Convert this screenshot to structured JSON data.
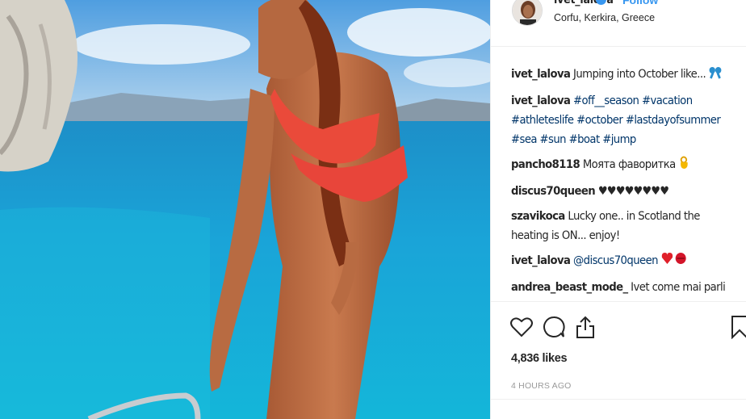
{
  "photo": {
    "alt_icon": "photo-of-woman-on-boat"
  },
  "header": {
    "username": "ivet_lalova",
    "follow_label": "Follow",
    "location": "Corfu, Kerkira, Greece"
  },
  "comments": [
    {
      "user": "ivet_lalova",
      "text": "Jumping into October like...",
      "emoji": "ribbon-icon"
    },
    {
      "user": "ivet_lalova",
      "text": "#off__season #vacation #athleteslife #october #lastdayofsummer #sea #sun #boat #jump"
    },
    {
      "user": "pancho8118",
      "text": "Моята фаворитка",
      "emoji": "ok-hand-icon"
    },
    {
      "user": "discus70queen",
      "text": "♥♥♥♥♥♥♥♥"
    },
    {
      "user": "szavikoca",
      "text": "Lucky one.. in Scotland the heating is ON... enjoy!"
    },
    {
      "user": "ivet_lalova",
      "mention": "@discus70queen",
      "emoji": "heart-lips-icon"
    },
    {
      "user": "andrea_beast_mode_",
      "text": "Ivet come mai parli"
    }
  ],
  "actions": {
    "likes": "4,836 likes",
    "time": "4 HOURS AGO",
    "icons": [
      "heart-icon",
      "comment-icon",
      "share-icon",
      "bookmark-icon"
    ]
  },
  "colors": {
    "link": "#003569",
    "follow": "#3897f0",
    "border": "#efefef",
    "text": "#262626",
    "muted": "#999999"
  }
}
